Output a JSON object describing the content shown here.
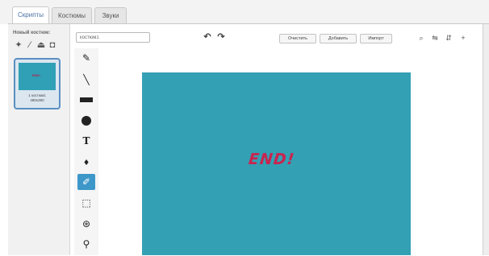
{
  "tabs": [
    {
      "label": "Скрипты",
      "active": true
    },
    {
      "label": "Костюмы",
      "active": false
    },
    {
      "label": "Звуки",
      "active": false
    }
  ],
  "sidebar": {
    "new_costume_label": "Новый костюм:",
    "new_costume_icons": [
      "paintbrush-icon",
      "pen-icon",
      "upload-icon",
      "camera-icon"
    ],
    "costume": {
      "number": "1",
      "name": "костюм1",
      "size": "480x360",
      "preview_text": "END!"
    }
  },
  "editor": {
    "name_value": "костюм1",
    "buttons": {
      "clear": "Очистить",
      "add": "Добавить",
      "import": "Импорт"
    },
    "canvas_text": "END!",
    "colors": {
      "canvas": "#34a0b4",
      "text": "#c8254f",
      "tool_active": "#3d97c9"
    },
    "tools": [
      "brush",
      "line",
      "rectangle",
      "ellipse",
      "text",
      "fill",
      "eraser",
      "select",
      "duplicate",
      "stamp"
    ]
  }
}
